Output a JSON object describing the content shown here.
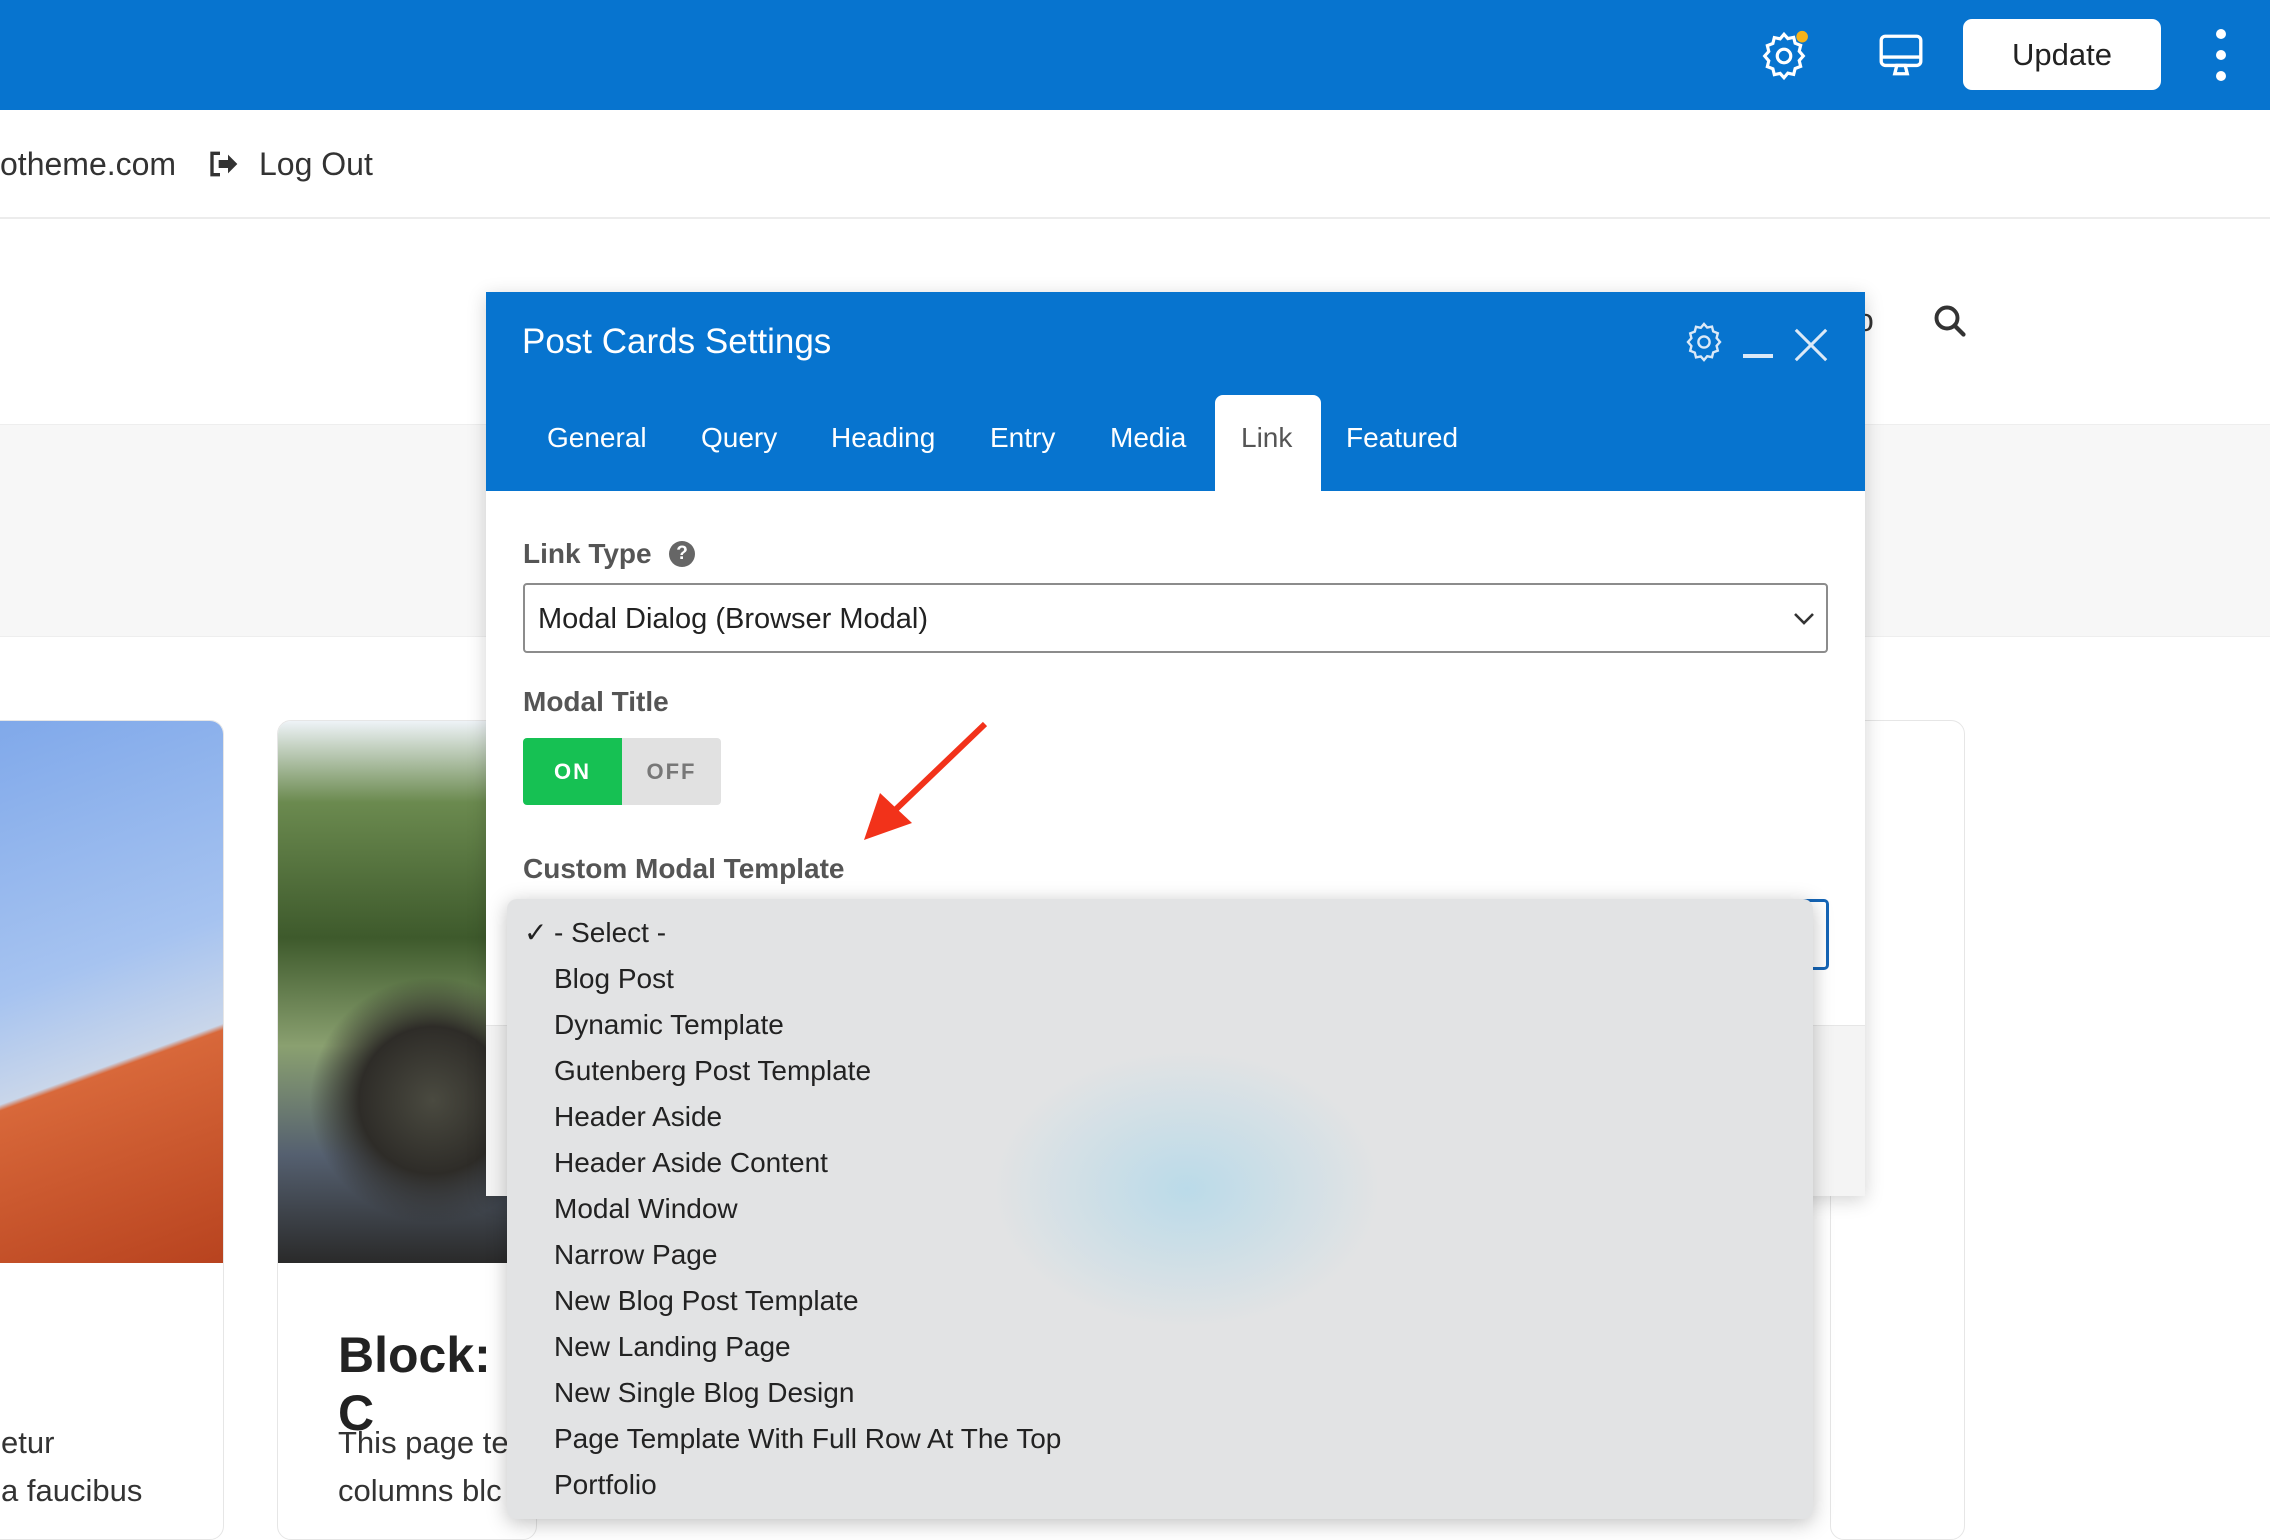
{
  "toolbar": {
    "update_label": "Update",
    "accent": "#0774cf",
    "notification_dot": "#f5b31a"
  },
  "adminbar": {
    "site_text": "otheme.com",
    "logout_label": "Log Out"
  },
  "page": {
    "nav_partial": "o",
    "card_title": "Block: C",
    "card1_text": [
      "etur",
      "a faucibus"
    ],
    "card2_text": [
      "This page te",
      "columns blc"
    ]
  },
  "modal": {
    "title": "Post Cards Settings",
    "tabs": [
      "General",
      "Query",
      "Heading",
      "Entry",
      "Media",
      "Link",
      "Featured"
    ],
    "active_tab": "Link",
    "link_type_label": "Link Type",
    "link_type_value": "Modal Dialog (Browser Modal)",
    "modal_title_label": "Modal Title",
    "toggle": {
      "on": "ON",
      "off": "OFF",
      "state": "on"
    },
    "custom_template_label": "Custom Modal Template"
  },
  "dropdown": {
    "selected": "- Select -",
    "check": "✓",
    "options": [
      "- Select -",
      "Blog Post",
      "Dynamic Template",
      "Gutenberg Post Template",
      "Header Aside",
      "Header Aside Content",
      "Modal Window",
      "Narrow Page",
      "New Blog Post Template",
      "New Landing Page",
      "New Single Blog Design",
      "Page Template With Full Row At The Top",
      "Portfolio"
    ]
  }
}
